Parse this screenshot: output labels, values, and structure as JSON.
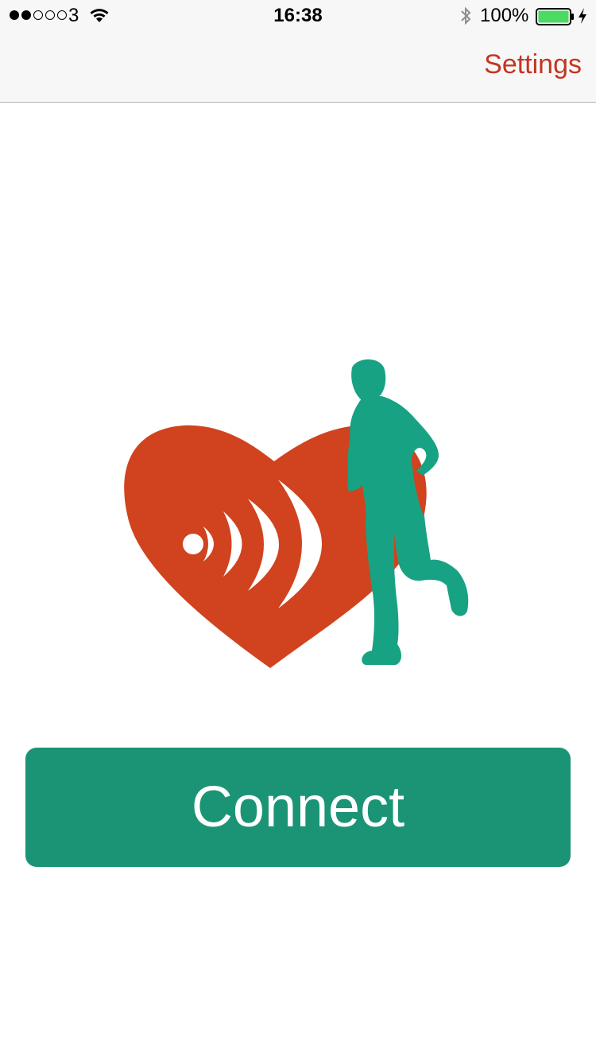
{
  "status_bar": {
    "signal_bars_filled": 2,
    "signal_bars_total": 5,
    "carrier": "3",
    "time": "16:38",
    "battery_percent": "100%",
    "battery_color": "#4cd964"
  },
  "nav_bar": {
    "settings_label": "Settings",
    "accent_color": "#c33521"
  },
  "logo": {
    "heart_icon": "heart-wireless-icon",
    "runner_icon": "runner-icon",
    "heart_color": "#d0431e",
    "runner_color": "#17a283"
  },
  "main": {
    "connect_label": "Connect",
    "button_color": "#1b9476"
  }
}
